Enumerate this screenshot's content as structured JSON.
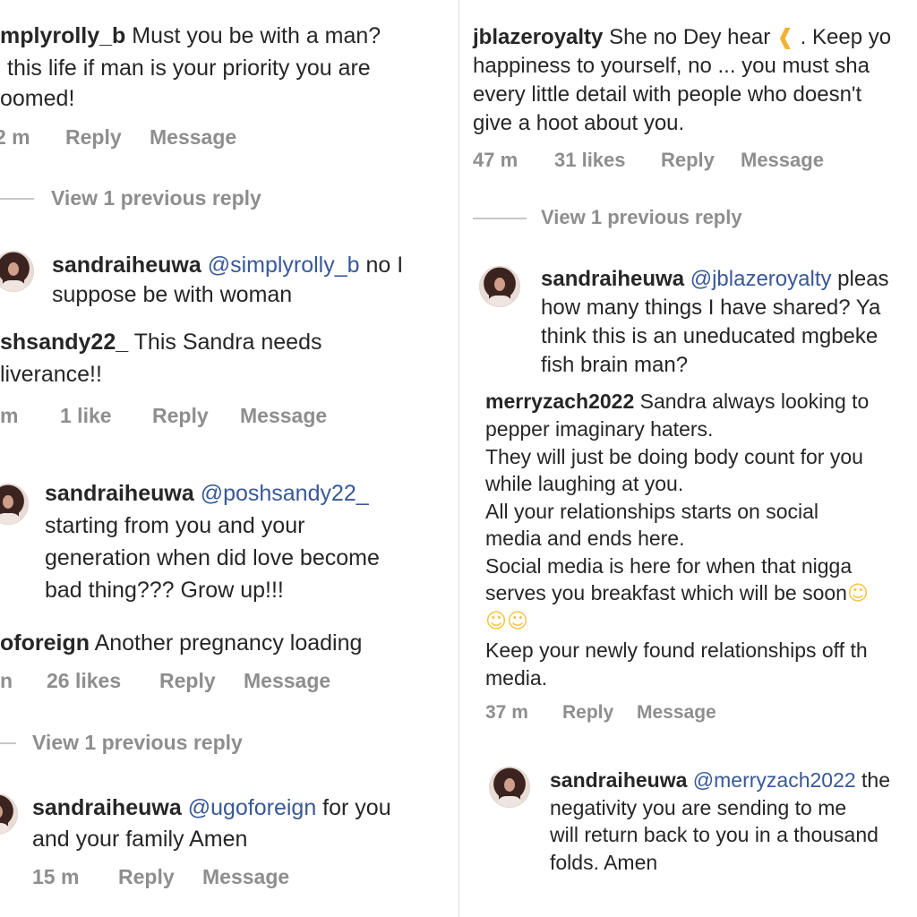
{
  "left": {
    "c1": {
      "user": "mplyrolly_b",
      "lines": [
        "Must you be with a man?",
        "this life if man is your priority you are",
        "oomed!"
      ],
      "time": "2 m",
      "reply": "Reply",
      "message": "Message"
    },
    "view1": "View 1 previous reply",
    "r1": {
      "user": "sandraiheuwa",
      "mention": "@simplyrolly_b",
      "text1": "no I",
      "text2": "suppose be with woman"
    },
    "c2": {
      "user": "shsandy22_",
      "text1": "This Sandra needs",
      "text2": "liverance!!",
      "time": "m",
      "likes": "1 like",
      "reply": "Reply",
      "message": "Message"
    },
    "r2": {
      "user": "sandraiheuwa",
      "mention": "@poshsandy22_",
      "lines": [
        "starting from you and your",
        "generation when did love become",
        "bad thing??? Grow up!!!"
      ]
    },
    "c3": {
      "user": "oforeign",
      "text": "Another pregnancy loading",
      "time": "n",
      "likes": "26 likes",
      "reply": "Reply",
      "message": "Message"
    },
    "view2": "View 1 previous reply",
    "r3": {
      "user": "sandraiheuwa",
      "mention": "@ugoforeign",
      "text1": "for you",
      "text2": "and your family Amen",
      "time": "15 m",
      "reply": "Reply",
      "message": "Message"
    }
  },
  "right": {
    "c1": {
      "user": "jblazeroyalty",
      "text1a": "She no Dey hear",
      "text1b": ". Keep yo",
      "lines": [
        "happiness to yourself, no ... you must sha",
        "every little detail with people who doesn't",
        "give a hoot about you."
      ],
      "time": "47 m",
      "likes": "31 likes",
      "reply": "Reply",
      "message": "Message"
    },
    "view1": "View 1 previous reply",
    "r1": {
      "user": "sandraiheuwa",
      "mention": "@jblazeroyalty",
      "text1": "pleas",
      "lines": [
        "how many things I have shared? Ya",
        "think this is an uneducated mgbeke",
        "fish brain man?"
      ]
    },
    "c2": {
      "user": "merryzach2022",
      "text1": "Sandra always looking to",
      "lines": [
        "pepper imaginary haters.",
        "They will just be doing body count for you",
        "while laughing at you.",
        "All your relationships starts on social",
        "media and ends here.",
        "Social media is here for when that nigga",
        "serves you breakfast which will be soon"
      ],
      "lines2": [
        "Keep your newly found relationships off th",
        "media."
      ],
      "time": "37 m",
      "reply": "Reply",
      "message": "Message"
    },
    "r2": {
      "user": "sandraiheuwa",
      "mention": "@merryzach2022",
      "text1": "the",
      "lines": [
        "negativity you are sending to me",
        "will return back to you in a thousand",
        "folds. Amen"
      ]
    }
  },
  "icons": {
    "ear": "ear-emoji-icon",
    "laugh": "laughing-emoji-icon",
    "avatar": "profile-avatar-icon"
  },
  "colors": {
    "text": "#262626",
    "meta": "#8e8e8e",
    "mention": "#385898"
  }
}
